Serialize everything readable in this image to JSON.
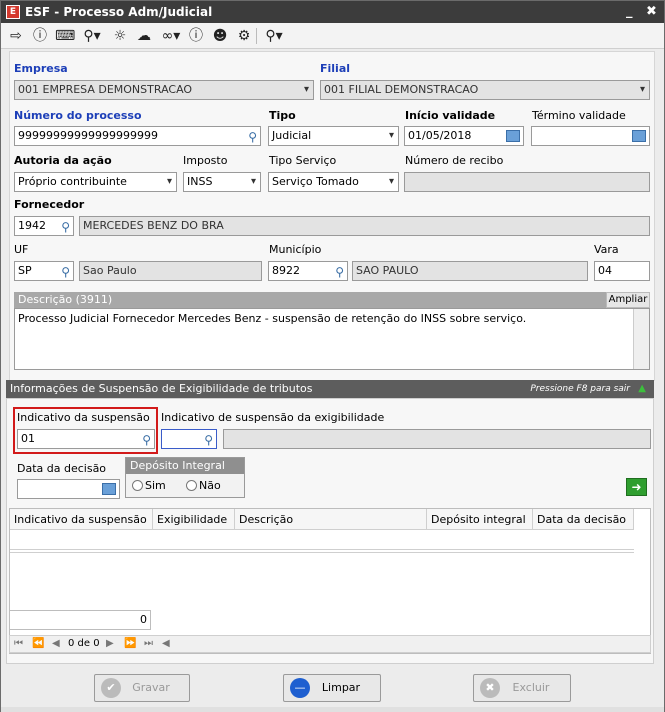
{
  "window": {
    "title": "ESF - Processo Adm/Judicial",
    "minimize": "_",
    "close": "✖"
  },
  "toolbar": {
    "icons": [
      "exit-icon",
      "help-icon",
      "keyboard-icon",
      "search-icon",
      "bulb-icon",
      "brain-icon",
      "link-icon",
      "info-icon",
      "user-icon",
      "document-gear-icon",
      "magnifier-report-icon"
    ]
  },
  "empresa": {
    "label": "Empresa",
    "value": "001 EMPRESA DEMONSTRACAO"
  },
  "filial": {
    "label": "Filial",
    "value": "001 FILIAL DEMONSTRACAO"
  },
  "numero": {
    "label": "Número do processo",
    "value": "99999999999999999999"
  },
  "tipo": {
    "label": "Tipo",
    "value": "Judicial"
  },
  "inicio": {
    "label": "Início validade",
    "value": "01/05/2018"
  },
  "termino": {
    "label": "Término validade",
    "value": ""
  },
  "autoria": {
    "label": "Autoria da ação",
    "value": "Próprio contribuinte"
  },
  "imposto": {
    "label": "Imposto",
    "value": "INSS"
  },
  "tipo_servico": {
    "label": "Tipo Serviço",
    "value": "Serviço Tomado"
  },
  "recibo": {
    "label": "Número de recibo",
    "value": ""
  },
  "fornecedor": {
    "label": "Fornecedor",
    "code": "1942",
    "name": "MERCEDES BENZ DO BRA"
  },
  "uf": {
    "label": "UF",
    "code": "SP",
    "name": "Sao Paulo"
  },
  "municipio": {
    "label": "Município",
    "code": "8922",
    "name": "SAO PAULO"
  },
  "vara": {
    "label": "Vara",
    "value": "04"
  },
  "descricao": {
    "header": "Descrição (3911)",
    "ampliar": "Ampliar",
    "text": "Processo Judicial Fornecedor Mercedes Benz - suspensão de retenção do INSS sobre serviço."
  },
  "suspensao": {
    "header": "Informações de Suspensão de Exigibilidade de tributos",
    "hint": "Pressione F8 para sair",
    "indicativo_label": "Indicativo da suspensão",
    "indicativo_value": "01",
    "exig_label": "Indicativo de suspensão da exigibilidade",
    "exig_value": "",
    "data_label": "Data da decisão",
    "deposito_label": "Depósito Integral",
    "sim": "Sim",
    "nao": "Não"
  },
  "grid": {
    "columns": [
      "Indicativo da suspensão",
      "Exigibilidade",
      "Descrição",
      "Depósito integral",
      "Data da decisão"
    ],
    "footer_count": "0",
    "pager": "0 de 0"
  },
  "buttons": {
    "gravar": "Gravar",
    "limpar": "Limpar",
    "excluir": "Excluir"
  }
}
